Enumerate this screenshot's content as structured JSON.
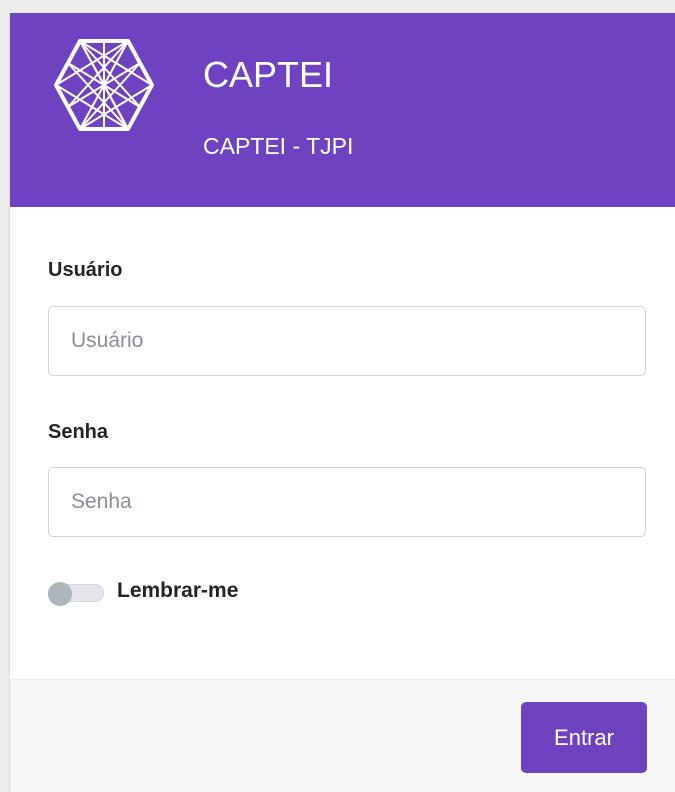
{
  "header": {
    "title": "CAPTEI",
    "subtitle": "CAPTEI - TJPI",
    "logo_icon": "hexagon-network-logo-icon",
    "color": "#6f42c1"
  },
  "form": {
    "username": {
      "label": "Usuário",
      "placeholder": "Usuário",
      "value": ""
    },
    "password": {
      "label": "Senha",
      "placeholder": "Senha",
      "value": ""
    },
    "remember": {
      "label": "Lembrar-me",
      "checked": false
    }
  },
  "footer": {
    "submit_label": "Entrar"
  }
}
